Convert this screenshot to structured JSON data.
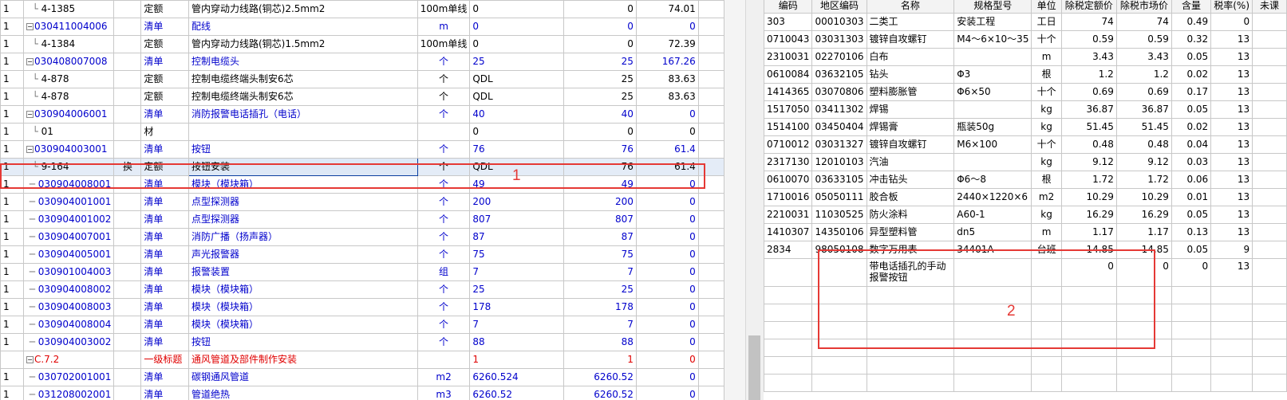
{
  "left_table": {
    "rows": [
      {
        "no": "1",
        "code": "4-1385",
        "mark": "",
        "type": "定额",
        "name": "管内穿动力线路(铜芯)2.5mm2",
        "unit": "100m单线",
        "qty_expr": "0",
        "qty": "0",
        "price": "74.01",
        "style": "normal",
        "indent": "leaf"
      },
      {
        "no": "1",
        "code": "030411004006",
        "mark": "",
        "type": "清单",
        "name": "配线",
        "unit": "m",
        "qty_expr": "0",
        "qty": "0",
        "price": "0",
        "style": "blue",
        "indent": "parent"
      },
      {
        "no": "1",
        "code": "4-1384",
        "mark": "",
        "type": "定额",
        "name": "管内穿动力线路(铜芯)1.5mm2",
        "unit": "100m单线",
        "qty_expr": "0",
        "qty": "0",
        "price": "72.39",
        "style": "normal",
        "indent": "leaf"
      },
      {
        "no": "1",
        "code": "030408007008",
        "mark": "",
        "type": "清单",
        "name": "控制电缆头",
        "unit": "个",
        "qty_expr": "25",
        "qty": "25",
        "price": "167.26",
        "style": "blue",
        "indent": "parent"
      },
      {
        "no": "1",
        "code": "4-878",
        "mark": "",
        "type": "定额",
        "name": "控制电缆终端头制安6芯",
        "unit": "个",
        "qty_expr": "QDL",
        "qty": "25",
        "price": "83.63",
        "style": "normal",
        "indent": "leaf"
      },
      {
        "no": "1",
        "code": "4-878",
        "mark": "",
        "type": "定额",
        "name": "控制电缆终端头制安6芯",
        "unit": "个",
        "qty_expr": "QDL",
        "qty": "25",
        "price": "83.63",
        "style": "normal",
        "indent": "leaf"
      },
      {
        "no": "1",
        "code": "030904006001",
        "mark": "",
        "type": "清单",
        "name": "消防报警电话插孔（电话）",
        "unit": "个",
        "qty_expr": "40",
        "qty": "40",
        "price": "0",
        "style": "blue",
        "indent": "parent"
      },
      {
        "no": "1",
        "code": "01",
        "mark": "",
        "type": "材",
        "name": "",
        "unit": "",
        "qty_expr": "0",
        "qty": "0",
        "price": "0",
        "style": "normal",
        "indent": "leaf"
      },
      {
        "no": "1",
        "code": "030904003001",
        "mark": "",
        "type": "清单",
        "name": "按钮",
        "unit": "个",
        "qty_expr": "76",
        "qty": "76",
        "price": "61.4",
        "style": "blue",
        "indent": "parent"
      },
      {
        "no": "1",
        "code": "9-164",
        "mark": "换",
        "type": "定额",
        "name": "按钮安装",
        "unit": "个",
        "qty_expr": "QDL",
        "qty": "76",
        "price": "61.4",
        "style": "selected",
        "indent": "leaf"
      },
      {
        "no": "1",
        "code": "030904008001",
        "mark": "",
        "type": "清单",
        "name": "模块（模块箱）",
        "unit": "个",
        "qty_expr": "49",
        "qty": "49",
        "price": "0",
        "style": "blue",
        "indent": "item"
      },
      {
        "no": "1",
        "code": "030904001001",
        "mark": "",
        "type": "清单",
        "name": "点型探测器",
        "unit": "个",
        "qty_expr": "200",
        "qty": "200",
        "price": "0",
        "style": "blue",
        "indent": "item"
      },
      {
        "no": "1",
        "code": "030904001002",
        "mark": "",
        "type": "清单",
        "name": "点型探测器",
        "unit": "个",
        "qty_expr": "807",
        "qty": "807",
        "price": "0",
        "style": "blue",
        "indent": "item"
      },
      {
        "no": "1",
        "code": "030904007001",
        "mark": "",
        "type": "清单",
        "name": "消防广播（扬声器）",
        "unit": "个",
        "qty_expr": "87",
        "qty": "87",
        "price": "0",
        "style": "blue",
        "indent": "item"
      },
      {
        "no": "1",
        "code": "030904005001",
        "mark": "",
        "type": "清单",
        "name": "声光报警器",
        "unit": "个",
        "qty_expr": "75",
        "qty": "75",
        "price": "0",
        "style": "blue",
        "indent": "item"
      },
      {
        "no": "1",
        "code": "030901004003",
        "mark": "",
        "type": "清单",
        "name": "报警装置",
        "unit": "组",
        "qty_expr": "7",
        "qty": "7",
        "price": "0",
        "style": "blue",
        "indent": "item"
      },
      {
        "no": "1",
        "code": "030904008002",
        "mark": "",
        "type": "清单",
        "name": "模块（模块箱）",
        "unit": "个",
        "qty_expr": "25",
        "qty": "25",
        "price": "0",
        "style": "blue",
        "indent": "item"
      },
      {
        "no": "1",
        "code": "030904008003",
        "mark": "",
        "type": "清单",
        "name": "模块（模块箱）",
        "unit": "个",
        "qty_expr": "178",
        "qty": "178",
        "price": "0",
        "style": "blue",
        "indent": "item"
      },
      {
        "no": "1",
        "code": "030904008004",
        "mark": "",
        "type": "清单",
        "name": "模块（模块箱）",
        "unit": "个",
        "qty_expr": "7",
        "qty": "7",
        "price": "0",
        "style": "blue",
        "indent": "item"
      },
      {
        "no": "1",
        "code": "030904003002",
        "mark": "",
        "type": "清单",
        "name": "按钮",
        "unit": "个",
        "qty_expr": "88",
        "qty": "88",
        "price": "0",
        "style": "blue",
        "indent": "item"
      },
      {
        "no": "",
        "code": "C.7.2",
        "mark": "",
        "type": "一级标题",
        "name": "通风管道及部件制作安装",
        "unit": "",
        "qty_expr": "1",
        "qty": "1",
        "price": "0",
        "style": "red",
        "indent": "heading"
      },
      {
        "no": "1",
        "code": "030702001001",
        "mark": "",
        "type": "清单",
        "name": "碳钢通风管道",
        "unit": "m2",
        "qty_expr": "6260.524",
        "qty": "6260.52",
        "price": "0",
        "style": "blue",
        "indent": "item"
      },
      {
        "no": "1",
        "code": "031208002001",
        "mark": "",
        "type": "清单",
        "name": "管道绝热",
        "unit": "m3",
        "qty_expr": "6260.52",
        "qty": "6260.52",
        "price": "0",
        "style": "blue",
        "indent": "item"
      }
    ]
  },
  "right_table": {
    "headers": [
      "编码",
      "地区编码",
      "名称",
      "规格型号",
      "单位",
      "除税定额价",
      "除税市场价",
      "含量",
      "税率(%)",
      "未课"
    ],
    "rows": [
      [
        "303",
        "00010303",
        "二类工",
        "安装工程",
        "工日",
        "74",
        "74",
        "0.49",
        "0",
        ""
      ],
      [
        "0710043",
        "03031303",
        "镀锌自攻螺钉",
        "M4～6×10～35",
        "十个",
        "0.59",
        "0.59",
        "0.32",
        "13",
        ""
      ],
      [
        "2310031",
        "02270106",
        "白布",
        "",
        "m",
        "3.43",
        "3.43",
        "0.05",
        "13",
        ""
      ],
      [
        "0610084",
        "03632105",
        "钻头",
        "Φ3",
        "根",
        "1.2",
        "1.2",
        "0.02",
        "13",
        ""
      ],
      [
        "1414365",
        "03070806",
        "塑料膨胀管",
        "Φ6×50",
        "十个",
        "0.69",
        "0.69",
        "0.17",
        "13",
        ""
      ],
      [
        "1517050",
        "03411302",
        "焊锡",
        "",
        "kg",
        "36.87",
        "36.87",
        "0.05",
        "13",
        ""
      ],
      [
        "1514100",
        "03450404",
        "焊锡膏",
        "瓶装50g",
        "kg",
        "51.45",
        "51.45",
        "0.02",
        "13",
        ""
      ],
      [
        "0710012",
        "03031327",
        "镀锌自攻螺钉",
        "M6×100",
        "十个",
        "0.48",
        "0.48",
        "0.04",
        "13",
        ""
      ],
      [
        "2317130",
        "12010103",
        "汽油",
        "",
        "kg",
        "9.12",
        "9.12",
        "0.03",
        "13",
        ""
      ],
      [
        "0610070",
        "03633105",
        "冲击钻头",
        "Φ6～8",
        "根",
        "1.72",
        "1.72",
        "0.06",
        "13",
        ""
      ],
      [
        "1710016",
        "05050111",
        "胶合板",
        "2440×1220×6",
        "m2",
        "10.29",
        "10.29",
        "0.01",
        "13",
        ""
      ],
      [
        "2210031",
        "11030525",
        "防火涂料",
        "A60-1",
        "kg",
        "16.29",
        "16.29",
        "0.05",
        "13",
        ""
      ],
      [
        "1410307",
        "14350106",
        "异型塑料管",
        "dn5",
        "m",
        "1.17",
        "1.17",
        "0.13",
        "13",
        ""
      ],
      [
        "2834",
        "98050108",
        "数字万用表",
        "34401A",
        "台班",
        "14.85",
        "14.85",
        "0.05",
        "9",
        ""
      ]
    ],
    "new_row": {
      "name": "带电话插孔的手动报警按钮",
      "market": "0",
      "price": "0",
      "content": "0",
      "tax": "13"
    }
  },
  "annotations": [
    {
      "label": "1"
    },
    {
      "label": "2"
    }
  ],
  "colors": {
    "annotation": "#e53935",
    "list_blue": "#0000cc",
    "heading_red": "#e00000"
  }
}
